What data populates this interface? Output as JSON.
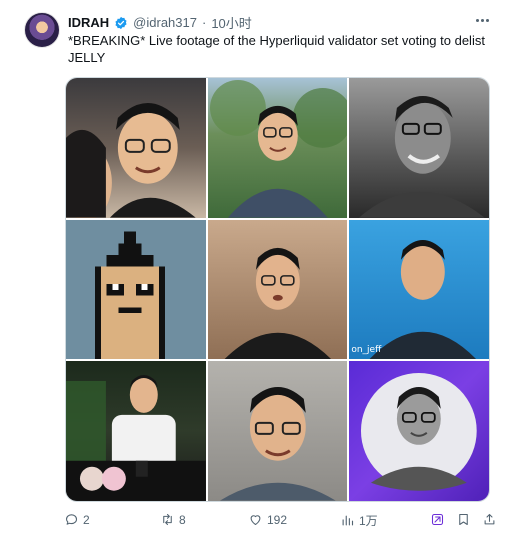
{
  "author": {
    "name": "IDRAH",
    "handle": "@idrah317",
    "separator": "·",
    "time": "10小时"
  },
  "post": {
    "text": "*BREAKING* Live footage of the Hyperliquid validator set voting to delist JELLY"
  },
  "media": {
    "tiles": [
      {
        "caption": ""
      },
      {
        "caption": ""
      },
      {
        "caption": ""
      },
      {
        "caption": ""
      },
      {
        "caption": ""
      },
      {
        "caption": "on_jeff"
      },
      {
        "caption": ""
      },
      {
        "caption": ""
      },
      {
        "caption": ""
      }
    ]
  },
  "actions": {
    "reply_count": "2",
    "repost_count": "8",
    "like_count": "192",
    "view_count": "1万"
  },
  "colors": {
    "verified": "#1d9bf0",
    "secondary_text": "#536471"
  },
  "icons": [
    "verified-badge-icon",
    "more-icon",
    "reply-icon",
    "repost-icon",
    "like-icon",
    "views-icon",
    "grok-icon",
    "bookmark-icon",
    "share-icon"
  ]
}
